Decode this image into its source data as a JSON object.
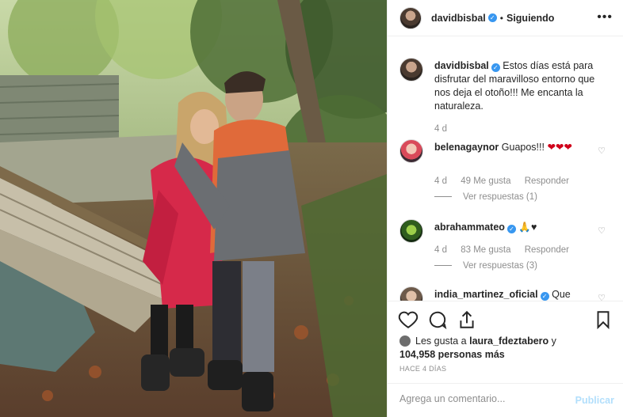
{
  "header": {
    "username": "davidbisbal",
    "separator": "•",
    "follow_label": "Siguiendo",
    "more_icon": "ellipsis-icon"
  },
  "caption": {
    "username": "davidbisbal",
    "text": "Estos días está para disfrutar del maravilloso entorno que nos deja el otoño!!! Me encanta la naturaleza.",
    "time": "4 d"
  },
  "comments": [
    {
      "username": "belenagaynor",
      "text": "Guapos!!!",
      "emoji": "❤❤❤",
      "time": "4 d",
      "likes": "49 Me gusta",
      "reply": "Responder",
      "view_replies": "Ver respuestas (1)"
    },
    {
      "username": "abrahammateo",
      "emoji": "🙏♥",
      "time": "4 d",
      "likes": "83 Me gusta",
      "reply": "Responder",
      "view_replies": "Ver respuestas (3)"
    },
    {
      "username": "india_martinez_oficial",
      "text": "Que"
    }
  ],
  "likes": {
    "prefix": "Les gusta a",
    "user": "laura_fdeztabero",
    "conj": "y",
    "count": "104,958 personas más"
  },
  "date": "HACE 4 DÍAS",
  "compose": {
    "placeholder": "Agrega un comentario...",
    "publish_label": "Publicar"
  },
  "colors": {
    "accent": "#3897f0",
    "publish_disabled": "#b2dffc",
    "muted": "#8e8e8e"
  }
}
